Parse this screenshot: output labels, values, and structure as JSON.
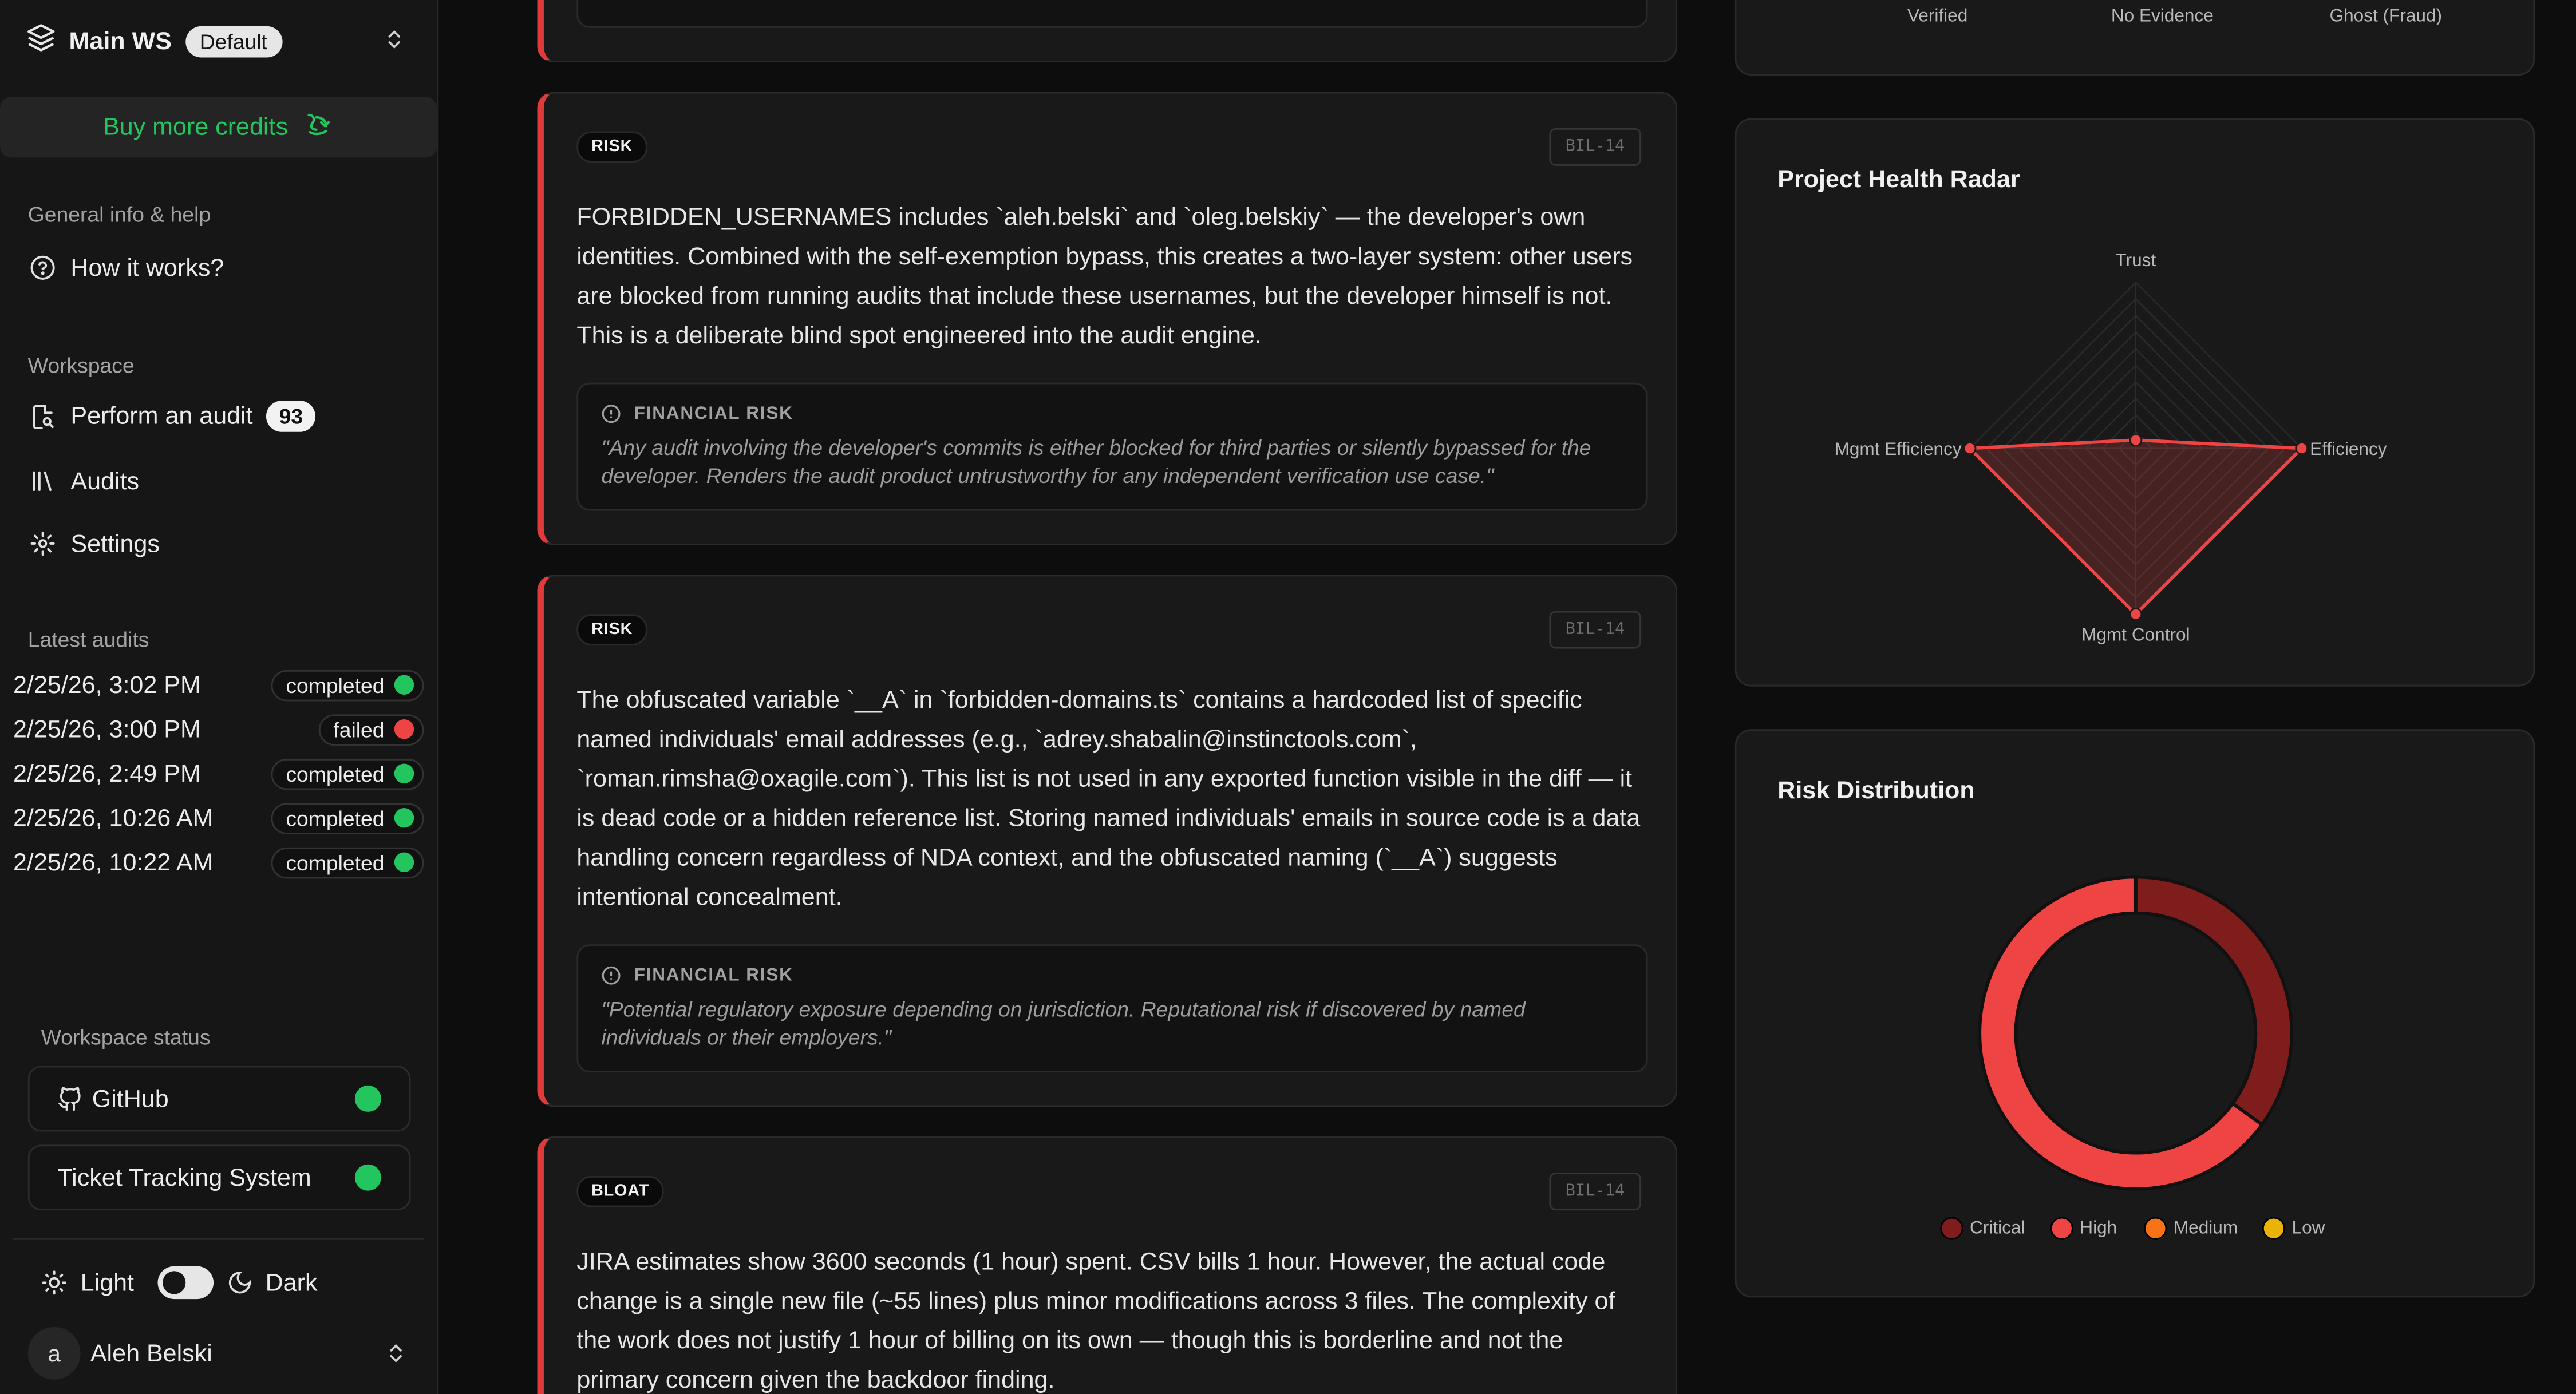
{
  "workspace": {
    "name": "Main WS",
    "badge": "Default",
    "buy_credits": "Buy more credits"
  },
  "sidebar": {
    "general_section": "General info & help",
    "how_it_works": "How it works?",
    "workspace_section": "Workspace",
    "perform_audit": "Perform an audit",
    "perform_audit_count": "93",
    "audits": "Audits",
    "settings": "Settings",
    "latest_audits_section": "Latest audits",
    "latest_audits": [
      {
        "date": "2/25/26, 3:02 PM",
        "status": "completed"
      },
      {
        "date": "2/25/26, 3:00 PM",
        "status": "failed"
      },
      {
        "date": "2/25/26, 2:49 PM",
        "status": "completed"
      },
      {
        "date": "2/25/26, 10:26 AM",
        "status": "completed"
      },
      {
        "date": "2/25/26, 10:22 AM",
        "status": "completed"
      }
    ],
    "workspace_status_section": "Workspace status",
    "integrations": [
      "GitHub",
      "Ticket Tracking System"
    ],
    "theme_light": "Light",
    "theme_dark": "Dark",
    "user_initial": "a",
    "user_name": "Aleh Belski"
  },
  "findings": [
    {
      "tag": "RISK",
      "ticket": "BIL-14",
      "body": "FORBIDDEN_USERNAMES includes `aleh.belski` and `oleg.belskiy` — the developer's own identities. Combined with the self-exemption bypass, this creates a two-layer system: other users are blocked from running audits that include these usernames, but the developer himself is not. This is a deliberate blind spot engineered into the audit engine.",
      "fin_title": "FINANCIAL RISK",
      "fin_quote": "\"Any audit involving the developer's commits is either blocked for third parties or silently bypassed for the developer. Renders the audit product untrustworthy for any independent verification use case.\""
    },
    {
      "tag": "RISK",
      "ticket": "BIL-14",
      "body": "The obfuscated variable `__A` in `forbidden-domains.ts` contains a hardcoded list of specific named individuals' email addresses (e.g., `adrey.shabalin@instinctools.com`, `roman.rimsha@oxagile.com`). This list is not used in any exported function visible in the diff — it is dead code or a hidden reference list. Storing named individuals' emails in source code is a data handling concern regardless of NDA context, and the obfuscated naming (`__A`) suggests intentional concealment.",
      "fin_title": "FINANCIAL RISK",
      "fin_quote": "\"Potential regulatory exposure depending on jurisdiction. Reputational risk if discovered by named individuals or their employers.\""
    },
    {
      "tag": "BLOAT",
      "ticket": "BIL-14",
      "body": "JIRA estimates show 3600 seconds (1 hour) spent. CSV bills 1 hour. However, the actual code change is a single new file (~55 lines) plus minor modifications across 3 files. The complexity of the work does not justify 1 hour of billing on its own — though this is borderline and not the primary concern given the backdoor finding."
    }
  ],
  "top_panel_labels": [
    "Verified",
    "No Evidence",
    "Ghost (Fraud)"
  ],
  "radar_panel": {
    "title": "Project Health Radar"
  },
  "risk_panel": {
    "title": "Risk Distribution"
  },
  "chart_data": [
    {
      "type": "radar",
      "title": "Project Health Radar",
      "axes": [
        "Trust",
        "Efficiency",
        "Mgmt Control",
        "Mgmt Efficiency"
      ],
      "values": [
        5,
        100,
        100,
        100
      ],
      "rlim": [
        0,
        100
      ],
      "color": "#ef4444"
    },
    {
      "type": "pie",
      "title": "Risk Distribution",
      "categories": [
        "Critical",
        "High",
        "Medium",
        "Low"
      ],
      "values": [
        35,
        65,
        0,
        0
      ],
      "colors": [
        "#7f1d1d",
        "#ef4444",
        "#f97316",
        "#eab308"
      ],
      "legend": "bottom"
    }
  ]
}
